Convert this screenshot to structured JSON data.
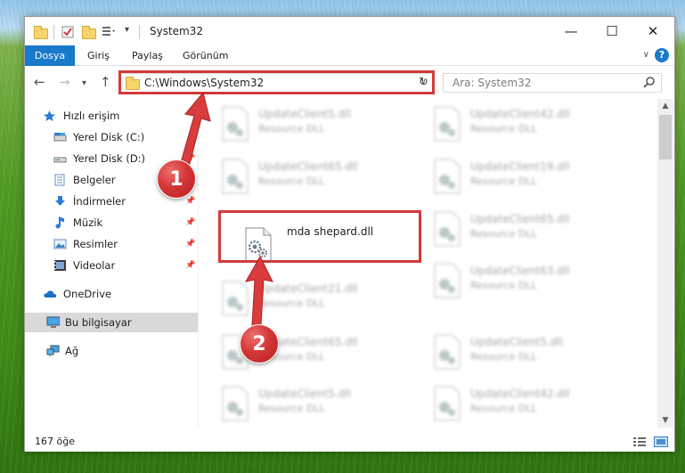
{
  "window": {
    "title": "System32",
    "controls": {
      "minimize": "—",
      "maximize": "☐",
      "close": "✕"
    }
  },
  "ribbon": {
    "tabs": [
      "Dosya",
      "Giriş",
      "Paylaş",
      "Görünüm"
    ],
    "help": "?"
  },
  "navigation": {
    "address": "C:\\Windows\\System32",
    "search_placeholder": "Ara: System32"
  },
  "sidebar": {
    "items": [
      {
        "label": "Hızlı erişim",
        "icon": "star-icon",
        "pinned": false
      },
      {
        "label": "Yerel Disk (C:)",
        "icon": "drive-icon",
        "pinned": false
      },
      {
        "label": "Yerel Disk (D:)",
        "icon": "drive-icon",
        "pinned": true
      },
      {
        "label": "Belgeler",
        "icon": "documents-icon",
        "pinned": true
      },
      {
        "label": "İndirmeler",
        "icon": "download-icon",
        "pinned": true
      },
      {
        "label": "Müzik",
        "icon": "music-icon",
        "pinned": true
      },
      {
        "label": "Resimler",
        "icon": "pictures-icon",
        "pinned": true
      },
      {
        "label": "Videolar",
        "icon": "video-icon",
        "pinned": true
      },
      {
        "label": "OneDrive",
        "icon": "cloud-icon",
        "pinned": false
      },
      {
        "label": "Bu bilgisayar",
        "icon": "computer-icon",
        "pinned": false,
        "selected": true
      },
      {
        "label": "Ağ",
        "icon": "network-icon",
        "pinned": false
      }
    ]
  },
  "files": {
    "left_column": [
      {
        "name": "UpdateClient5.dll",
        "type": "Resource DLL"
      },
      {
        "name": "UpdateClient65.dll",
        "type": "Resource DLL"
      },
      {
        "name": "mda shepard.dll",
        "type": "",
        "highlighted": true
      },
      {
        "name": "UpdateClient21.dll",
        "type": "Resource DLL"
      },
      {
        "name": "UpdateClient65.dll",
        "type": "Resource DLL"
      },
      {
        "name": "UpdateClient5.dll",
        "type": "Resource DLL"
      }
    ],
    "right_column": [
      {
        "name": "UpdateClient42.dll",
        "type": "Resource DLL"
      },
      {
        "name": "UpdateClient19.dll",
        "type": "Resource DLL"
      },
      {
        "name": "UpdateClient65.dll",
        "type": "Resource DLL"
      },
      {
        "name": "UpdateClient63.dll",
        "type": "Resource DLL"
      },
      {
        "name": "UpdateClient5.dll",
        "type": "Resource DLL"
      },
      {
        "name": "UpdateClient42.dll",
        "type": "Resource DLL"
      }
    ]
  },
  "status": {
    "count": "167 öğe"
  },
  "annotations": {
    "step1": "1",
    "step2": "2",
    "color": "#d23a3a"
  }
}
